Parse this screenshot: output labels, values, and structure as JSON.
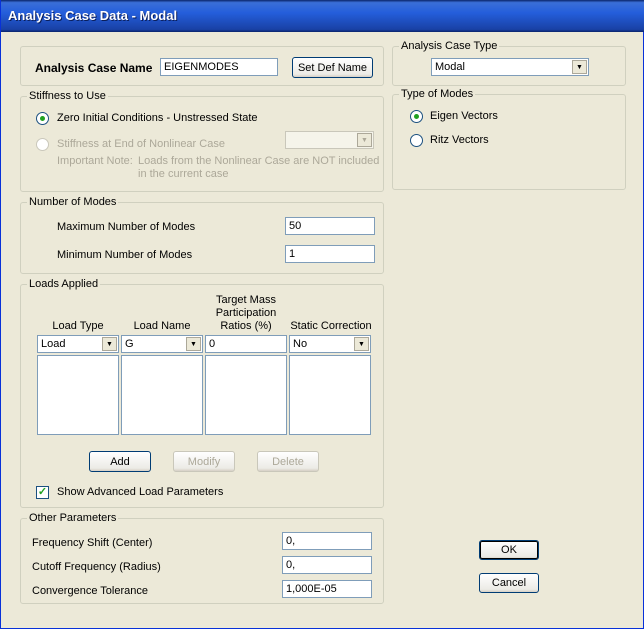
{
  "window": {
    "title": "Analysis Case Data - Modal"
  },
  "case_name": {
    "label": "Analysis Case Name",
    "value": "EIGENMODES",
    "set_def_label": "Set Def Name"
  },
  "stiffness": {
    "title": "Stiffness to Use",
    "option_zero": "Zero Initial Conditions - Unstressed State",
    "option_nonlinear": "Stiffness at End of Nonlinear Case",
    "note_label": "Important Note:",
    "note_line1": "Loads from the Nonlinear Case are NOT included",
    "note_line2": "in the current case",
    "selected": "zero"
  },
  "modes": {
    "title": "Number of Modes",
    "max_label": "Maximum Number of Modes",
    "max_value": "50",
    "min_label": "Minimum Number of Modes",
    "min_value": "1"
  },
  "loads": {
    "title": "Loads Applied",
    "col_load_type": "Load Type",
    "col_load_name": "Load Name",
    "col_target_l1": "Target Mass",
    "col_target_l2": "Participation",
    "col_target_l3": "Ratios (%)",
    "col_static": "Static Correction",
    "load_type_value": "Load",
    "load_name_value": "G",
    "target_value": "0",
    "static_value": "No",
    "add_label": "Add",
    "modify_label": "Modify",
    "delete_label": "Delete",
    "show_advanced_label": "Show Advanced Load Parameters",
    "show_advanced_checked": true
  },
  "other": {
    "title": "Other Parameters",
    "freq_shift_label": "Frequency Shift (Center)",
    "freq_shift_value": "0,",
    "cutoff_label": "Cutoff Frequency (Radius)",
    "cutoff_value": "0,",
    "tol_label": "Convergence Tolerance",
    "tol_value": "1,000E-05"
  },
  "case_type": {
    "title": "Analysis Case Type",
    "value": "Modal"
  },
  "type_modes": {
    "title": "Type of Modes",
    "eigen_label": "Eigen Vectors",
    "ritz_label": "Ritz Vectors",
    "selected": "eigen"
  },
  "buttons": {
    "ok_label": "OK",
    "cancel_label": "Cancel"
  },
  "colors": {
    "title_bar": "#245edb",
    "dialog_bg": "#ece9d8",
    "radio_dot": "#21a121"
  }
}
